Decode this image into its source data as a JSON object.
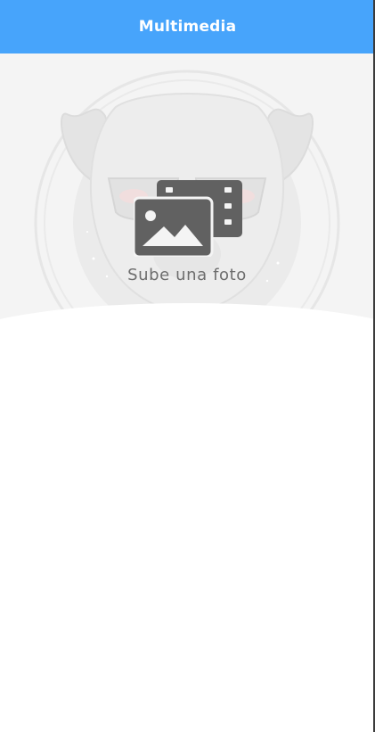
{
  "header": {
    "title": "Multimedia"
  },
  "upload": {
    "label": "Sube una foto",
    "icon": "photo-video-icon"
  },
  "hero": {
    "background_image": "dog-with-sunglasses-illustration"
  },
  "colors": {
    "app_bar": "#47a4fb",
    "hero_bg": "#f4f4f4",
    "icon": "#616161",
    "label": "#6d6d6d"
  }
}
